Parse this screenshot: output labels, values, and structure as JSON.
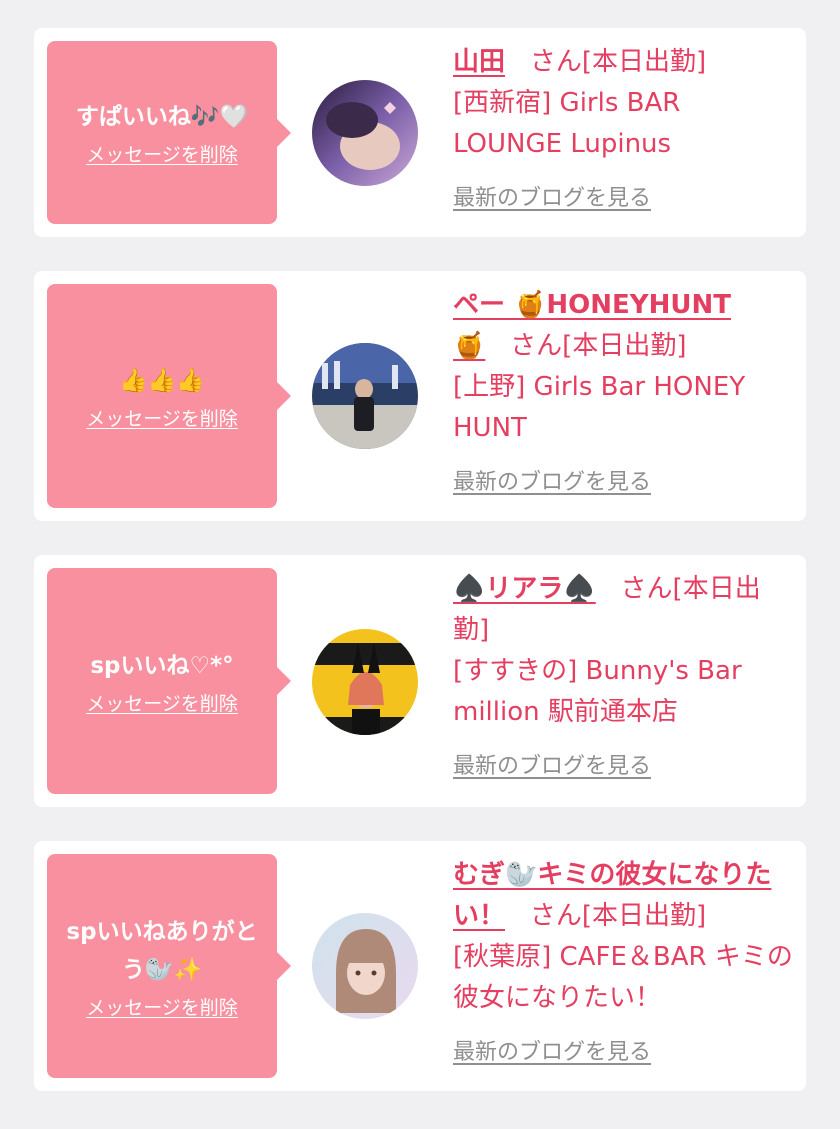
{
  "cards": [
    {
      "message": "すぱいいね🎶🤍",
      "delete_label": "メッセージを削除",
      "name": "山田",
      "suffix": "さん[本日出勤]",
      "shop": "[西新宿] Girls BAR LOUNGE Lupinus",
      "blog_label": "最新のブログを見る"
    },
    {
      "message": "👍👍👍",
      "delete_label": "メッセージを削除",
      "name": "ペー 🍯HONEYHUNT🍯",
      "suffix": "さん[本日出勤]",
      "shop": "[上野] Girls Bar HONEY HUNT",
      "blog_label": "最新のブログを見る"
    },
    {
      "message": "spいいね♡*°",
      "delete_label": "メッセージを削除",
      "name": "♠️リアラ♠️",
      "suffix": "さん[本日出勤]",
      "shop": "[すすきの] Bunny's Bar million 駅前通本店",
      "blog_label": "最新のブログを見る"
    },
    {
      "message": "spいいねありがとう🦭✨",
      "delete_label": "メッセージを削除",
      "name": "むぎ🦭キミの彼女になりたい！",
      "suffix": "さん[本日出勤]",
      "shop": "[秋葉原] CAFE＆BAR キミの彼女になりたい！",
      "blog_label": "最新のブログを見る"
    }
  ]
}
